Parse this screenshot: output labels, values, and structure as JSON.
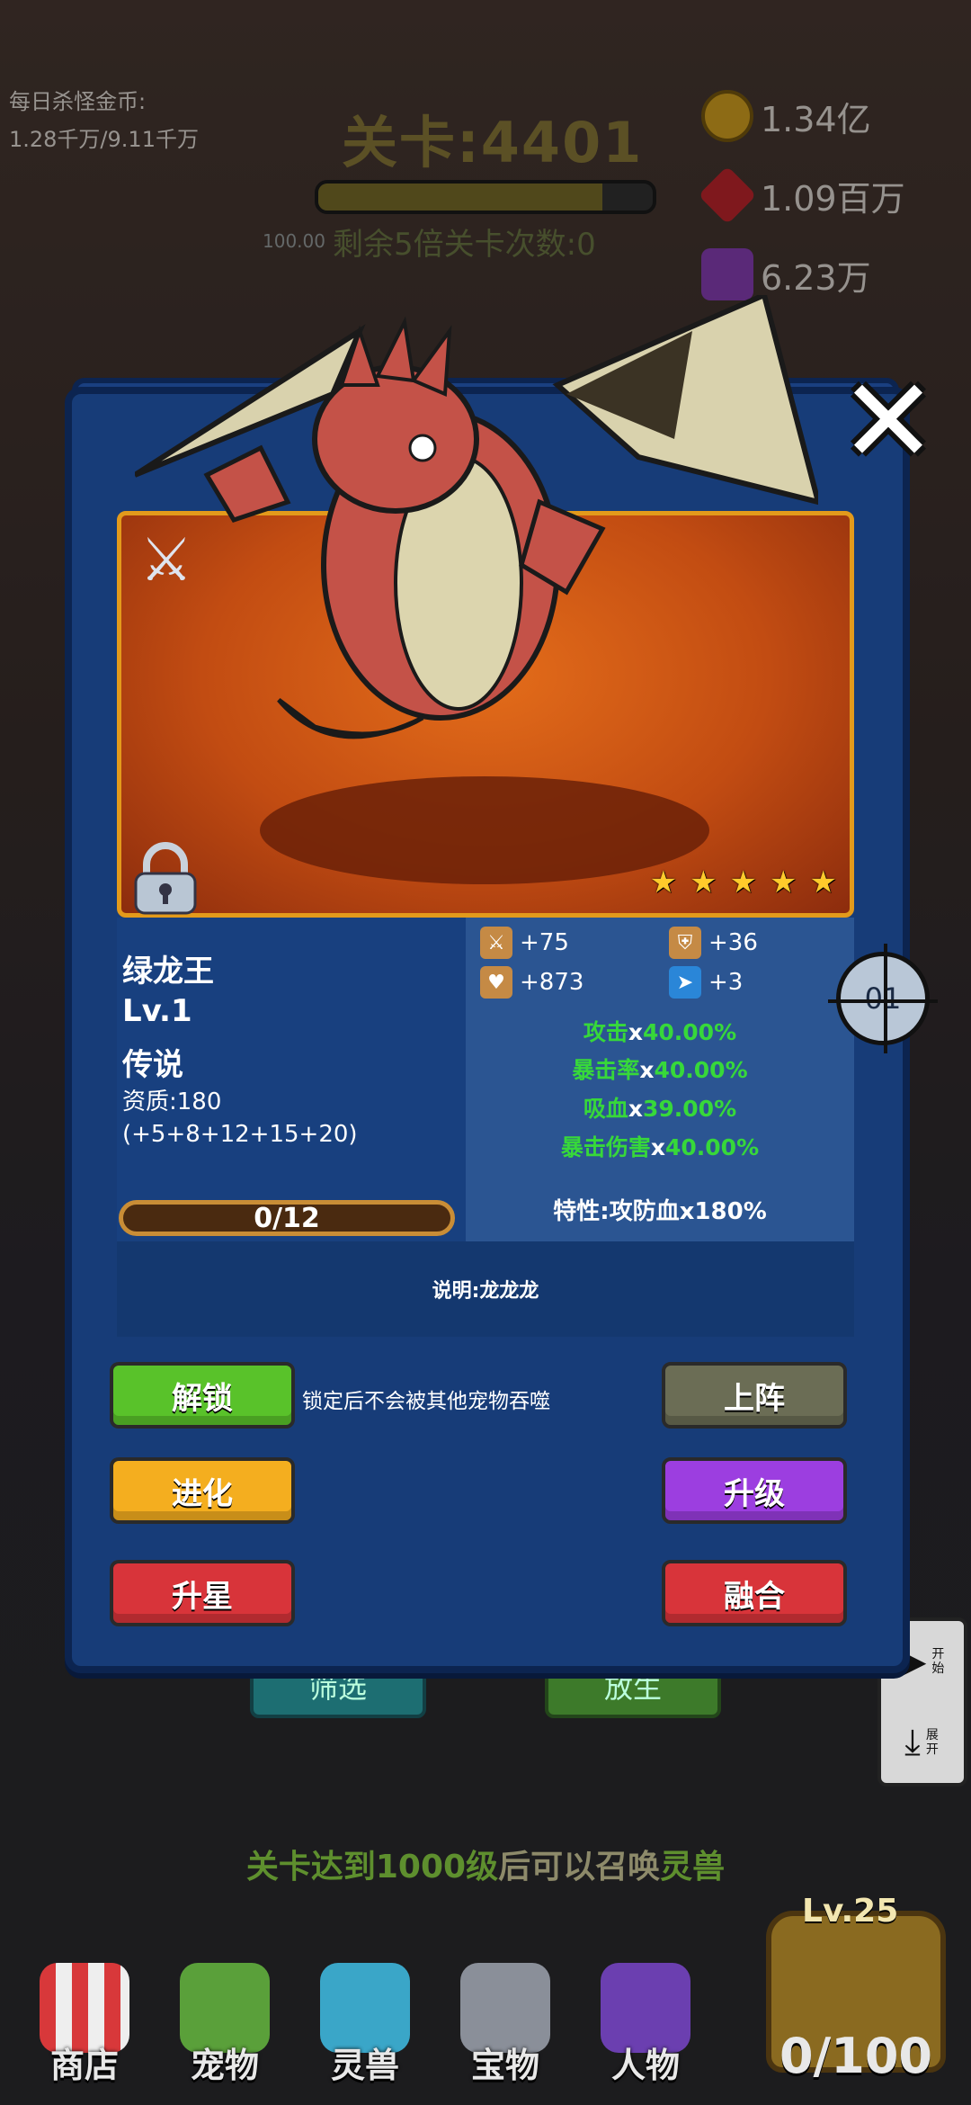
{
  "hud": {
    "daily_gold_label": "每日杀怪金币:",
    "daily_gold_value": "1.28千万/9.11千万",
    "level_title": "关卡:4401",
    "level_progress": 0.85,
    "remain_text": "剩余5倍关卡次数:0",
    "hp_text": "100.00",
    "currencies": [
      {
        "icon": "gold-coin-icon",
        "value": "1.34亿",
        "color": "#d9a521"
      },
      {
        "icon": "red-gem-icon",
        "value": "1.09百万",
        "color": "#c4262d"
      },
      {
        "icon": "purple-gem-icon",
        "value": "6.23万",
        "color": "#8b3fb8"
      }
    ]
  },
  "modal": {
    "close_icon": "close-icon",
    "pet": {
      "name": "绿龙王",
      "level": "Lv.1",
      "rarity": "传说",
      "quality": "资质:180",
      "quality_detail": "(+5+8+12+15+20)",
      "exp": "0/12",
      "stars": 5
    },
    "stats": {
      "attack": "+75",
      "defense": "+36",
      "hp": "+873",
      "speed": "+3"
    },
    "bonuses": [
      {
        "name": "攻击",
        "mult": "x",
        "value": "40.00%"
      },
      {
        "name": "暴击率",
        "mult": "x",
        "value": "40.00%"
      },
      {
        "name": "吸血",
        "mult": "x",
        "value": "39.00%"
      },
      {
        "name": "暴击伤害",
        "mult": "x",
        "value": "40.00%"
      }
    ],
    "trait": "特性:攻防血x180%",
    "description": "说明:龙龙龙",
    "lock_note": "锁定后不会被其他宠物吞噬",
    "buttons": {
      "unlock": "解锁",
      "deploy": "上阵",
      "evolve": "进化",
      "upgrade": "升级",
      "star_up": "升星",
      "fuse": "融合"
    },
    "target_label": "01"
  },
  "background": {
    "filter_label": "筛选",
    "release_label": "放生",
    "summon_hint_a": "关卡达到1000级",
    "summon_hint_b": "后可以召唤",
    "summon_hint_c": "灵兽",
    "side_play_label": "开始",
    "side_expand_label": "展开"
  },
  "nav": {
    "items": [
      {
        "label": "商店",
        "icon": "shop-icon"
      },
      {
        "label": "宠物",
        "icon": "pet-icon"
      },
      {
        "label": "灵兽",
        "icon": "spirit-beast-icon"
      },
      {
        "label": "宝物",
        "icon": "treasure-icon"
      },
      {
        "label": "人物",
        "icon": "character-icon"
      }
    ],
    "chest_level": "Lv.25",
    "chest_count": "0/100"
  }
}
